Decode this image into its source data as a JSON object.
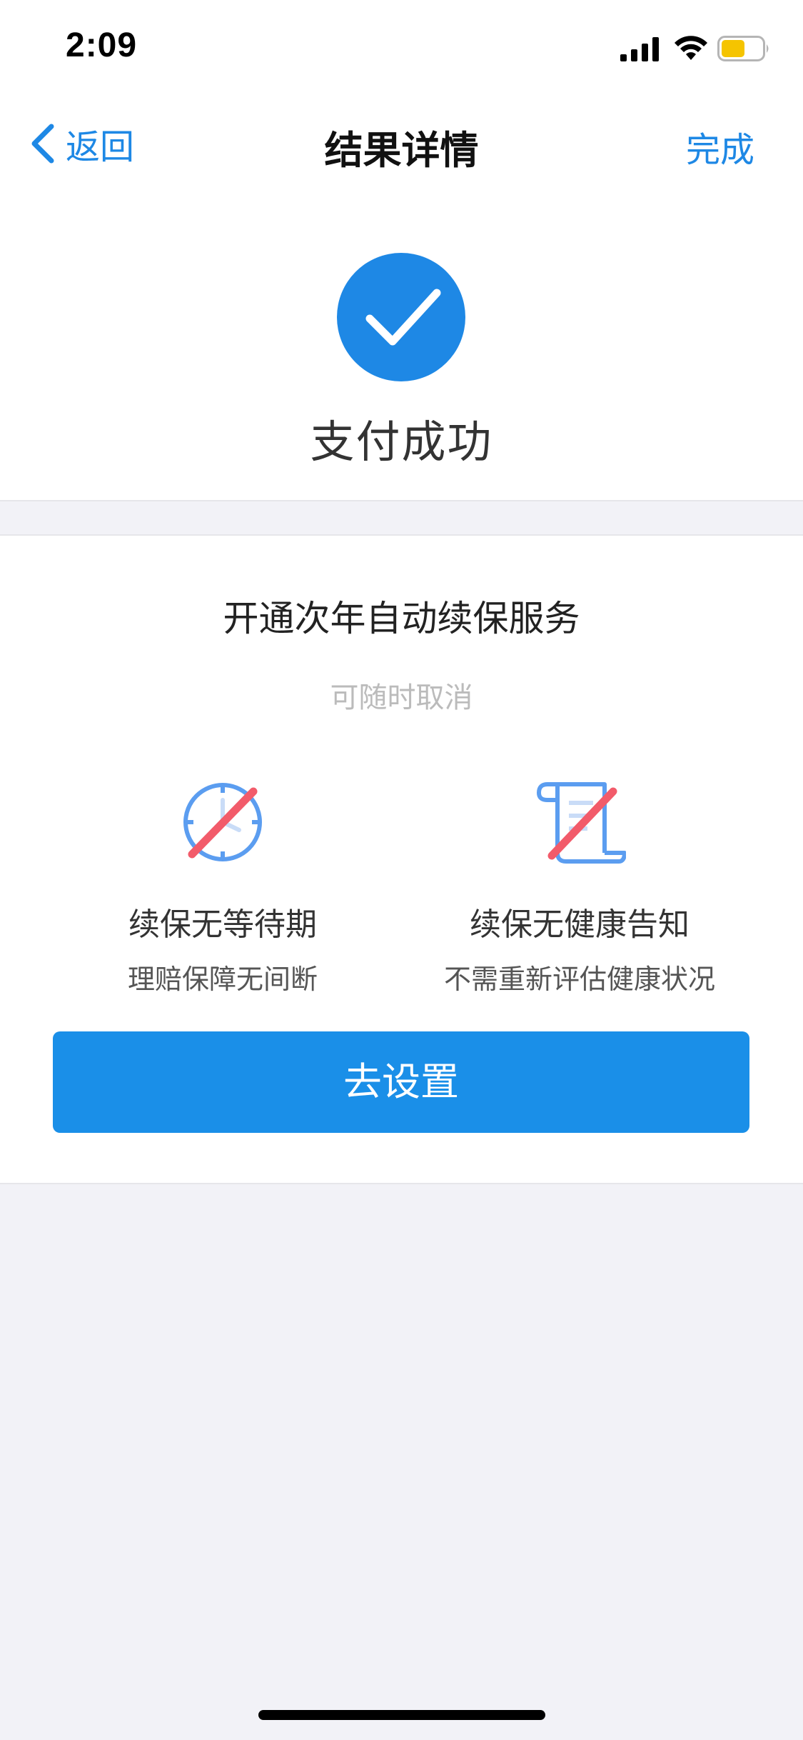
{
  "status_bar": {
    "time": "2:09"
  },
  "nav": {
    "back_label": "返回",
    "title": "结果详情",
    "done_label": "完成"
  },
  "success": {
    "message": "支付成功"
  },
  "renewal": {
    "title": "开通次年自动续保服务",
    "subtitle": "可随时取消",
    "features": [
      {
        "title": "续保无等待期",
        "desc": "理赔保障无间断",
        "icon": "clock-crossed-icon"
      },
      {
        "title": "续保无健康告知",
        "desc": "不需重新评估健康状况",
        "icon": "scroll-crossed-icon"
      }
    ],
    "button_label": "去设置"
  },
  "colors": {
    "accent": "#1e88e5",
    "button": "#1a8fe8",
    "cross_red": "#f25b6a",
    "battery": "#f5c400"
  }
}
